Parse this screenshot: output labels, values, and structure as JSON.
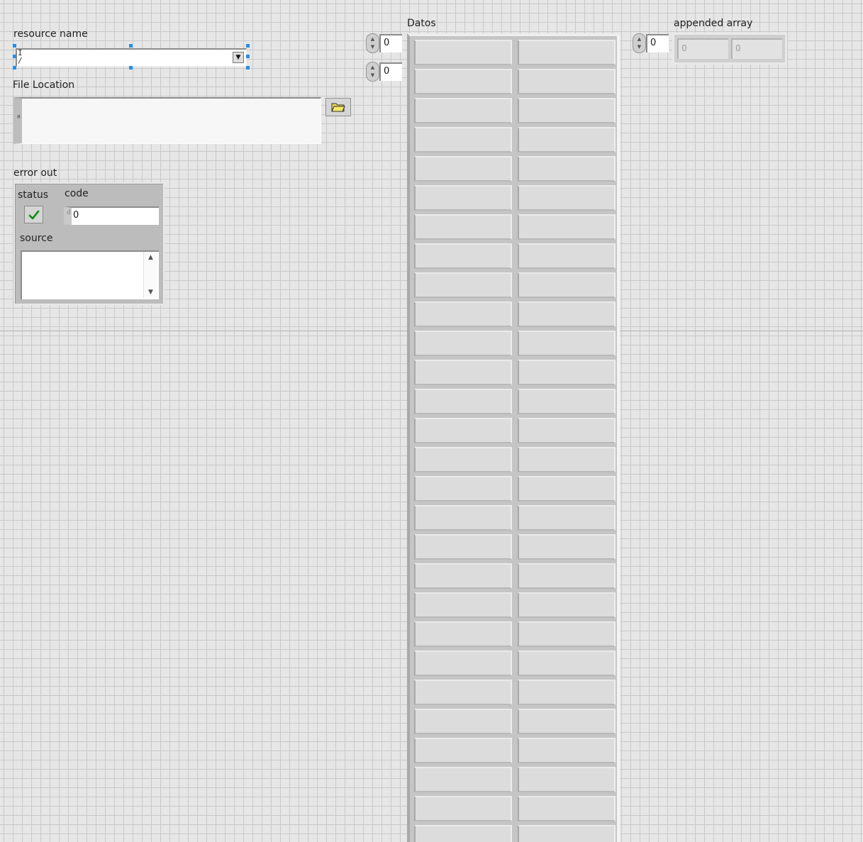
{
  "resource_name": {
    "label": "resource name",
    "value": "",
    "io_icon": "I/O"
  },
  "file_location": {
    "label": "File Location",
    "value": "",
    "path_icon": "path-icon",
    "browse_icon": "open-folder-icon"
  },
  "error_out": {
    "label": "error out",
    "status_label": "status",
    "status_icon": "checkmark-icon",
    "status_color": "#2fb52f",
    "code_label": "code",
    "code_radix": "d",
    "code_value": "0",
    "source_label": "source",
    "source_value": ""
  },
  "datos": {
    "label": "Datos",
    "row_index": "0",
    "col_index": "0",
    "columns": 2,
    "rows": 28
  },
  "appended_array": {
    "label": "appended array",
    "index": "0",
    "values": [
      "0",
      "0"
    ]
  }
}
